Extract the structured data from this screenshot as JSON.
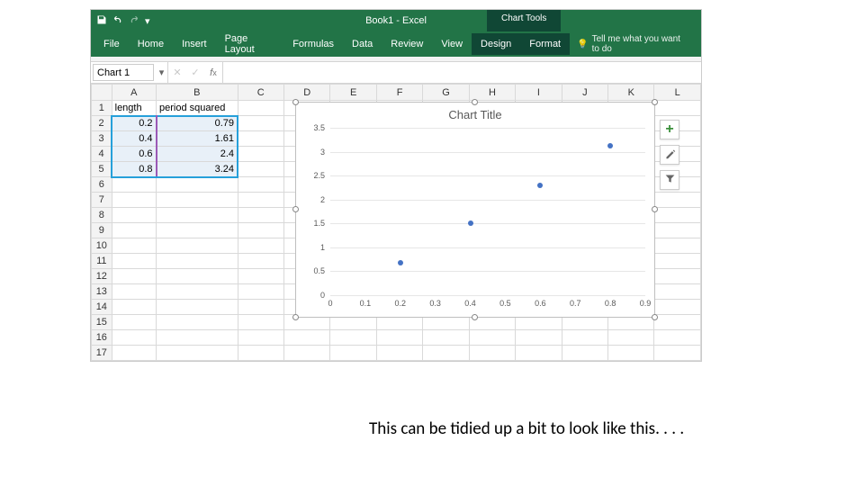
{
  "titlebar": {
    "doc_title": "Book1 - Excel",
    "chart_tools_label": "Chart Tools"
  },
  "ribbon": {
    "tabs": [
      "File",
      "Home",
      "Insert",
      "Page Layout",
      "Formulas",
      "Data",
      "Review",
      "View",
      "Design",
      "Format"
    ],
    "tellme": "Tell me what you want to do"
  },
  "namebox": {
    "value": "Chart 1"
  },
  "columns": [
    "A",
    "B",
    "C",
    "D",
    "E",
    "F",
    "G",
    "H",
    "I",
    "J",
    "K",
    "L"
  ],
  "rows": [
    "1",
    "2",
    "3",
    "4",
    "5",
    "6",
    "7",
    "8",
    "9",
    "10",
    "11",
    "12",
    "13",
    "14",
    "15",
    "16",
    "17"
  ],
  "headers": {
    "a": "length",
    "b": "period squared"
  },
  "data_rows": [
    {
      "a": "0.2",
      "b": "0.79"
    },
    {
      "a": "0.4",
      "b": "1.61"
    },
    {
      "a": "0.6",
      "b": "2.4"
    },
    {
      "a": "0.8",
      "b": "3.24"
    }
  ],
  "chart_data": {
    "type": "scatter",
    "title": "Chart Title",
    "xlabel": "",
    "ylabel": "",
    "xlim": [
      0,
      0.9
    ],
    "ylim": [
      0,
      3.5
    ],
    "x_ticks": [
      0,
      0.1,
      0.2,
      0.3,
      0.4,
      0.5,
      0.6,
      0.7,
      0.8,
      0.9
    ],
    "y_ticks": [
      0,
      0.5,
      1,
      1.5,
      2,
      2.5,
      3,
      3.5
    ],
    "series": [
      {
        "name": "period squared",
        "x": [
          0.2,
          0.4,
          0.6,
          0.8
        ],
        "y": [
          0.79,
          1.61,
          2.4,
          3.24
        ],
        "color": "#4472c4"
      }
    ]
  },
  "side_buttons": {
    "add": "chart-elements-button",
    "style": "chart-styles-button",
    "filter": "chart-filters-button"
  },
  "caption": "This can be tidied up a bit to look like this. . . ."
}
